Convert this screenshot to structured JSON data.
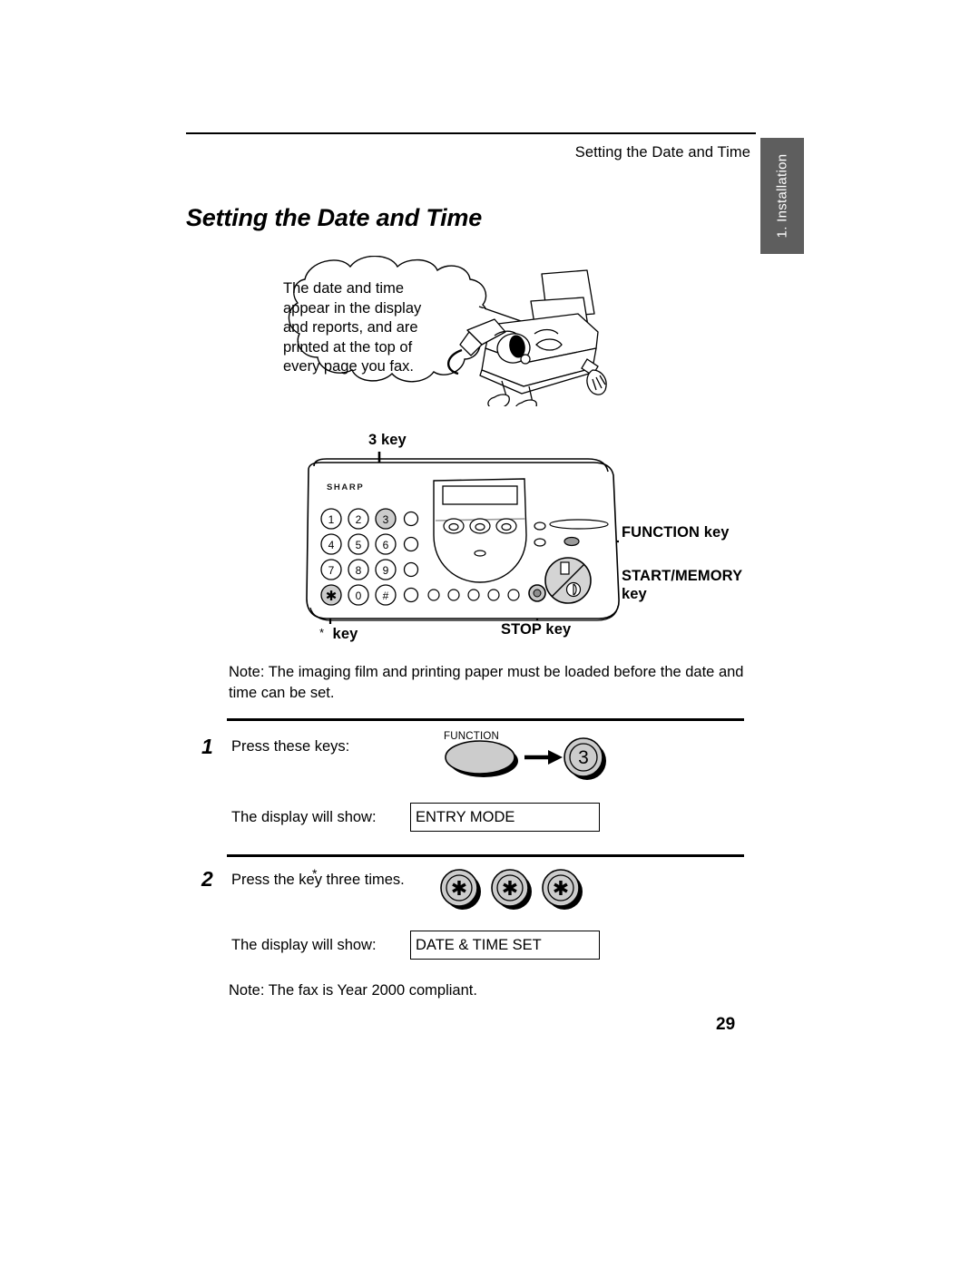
{
  "header": {
    "running_head": "Setting the Date and Time",
    "side_tab": "1. Installation"
  },
  "page_title": "Setting the Date and Time",
  "bubble": {
    "text": "The date and time appear in the display and reports, and are printed at the top of every page you fax."
  },
  "diagram": {
    "brand": "SHARP",
    "keypad": [
      "1",
      "2",
      "3",
      "4",
      "5",
      "6",
      "7",
      "8",
      "9",
      "*",
      "0",
      "#"
    ],
    "highlighted_keys": [
      "3",
      "*"
    ],
    "callouts": {
      "three_key": "3 key",
      "star_key_symbol": "*",
      "star_key": "key",
      "stop_key": "STOP  key",
      "function_key": "FUNCTION  key",
      "start_memory_key": "START/MEMORY",
      "start_memory_key_line2": "key"
    }
  },
  "note_top": "Note: The imaging film and printing paper must be loaded before the date and time can be set.",
  "steps": [
    {
      "number": "1",
      "text": "Press these keys:",
      "function_caption": "FUNCTION",
      "key_label": "3",
      "display_label": "The display will show:",
      "display_value": "ENTRY MODE"
    },
    {
      "number": "2",
      "text": "Press the    key three times.",
      "star_symbol": "*",
      "key_label": "✳",
      "display_label": "The display will show:",
      "display_value": "DATE & TIME SET"
    }
  ],
  "note_bottom": "Note: The fax  is Year 2000 compliant.",
  "page_number": "29",
  "colors": {
    "tab_background": "#5e5e5e",
    "key_fill": "#cccccc",
    "ink": "#000000"
  }
}
